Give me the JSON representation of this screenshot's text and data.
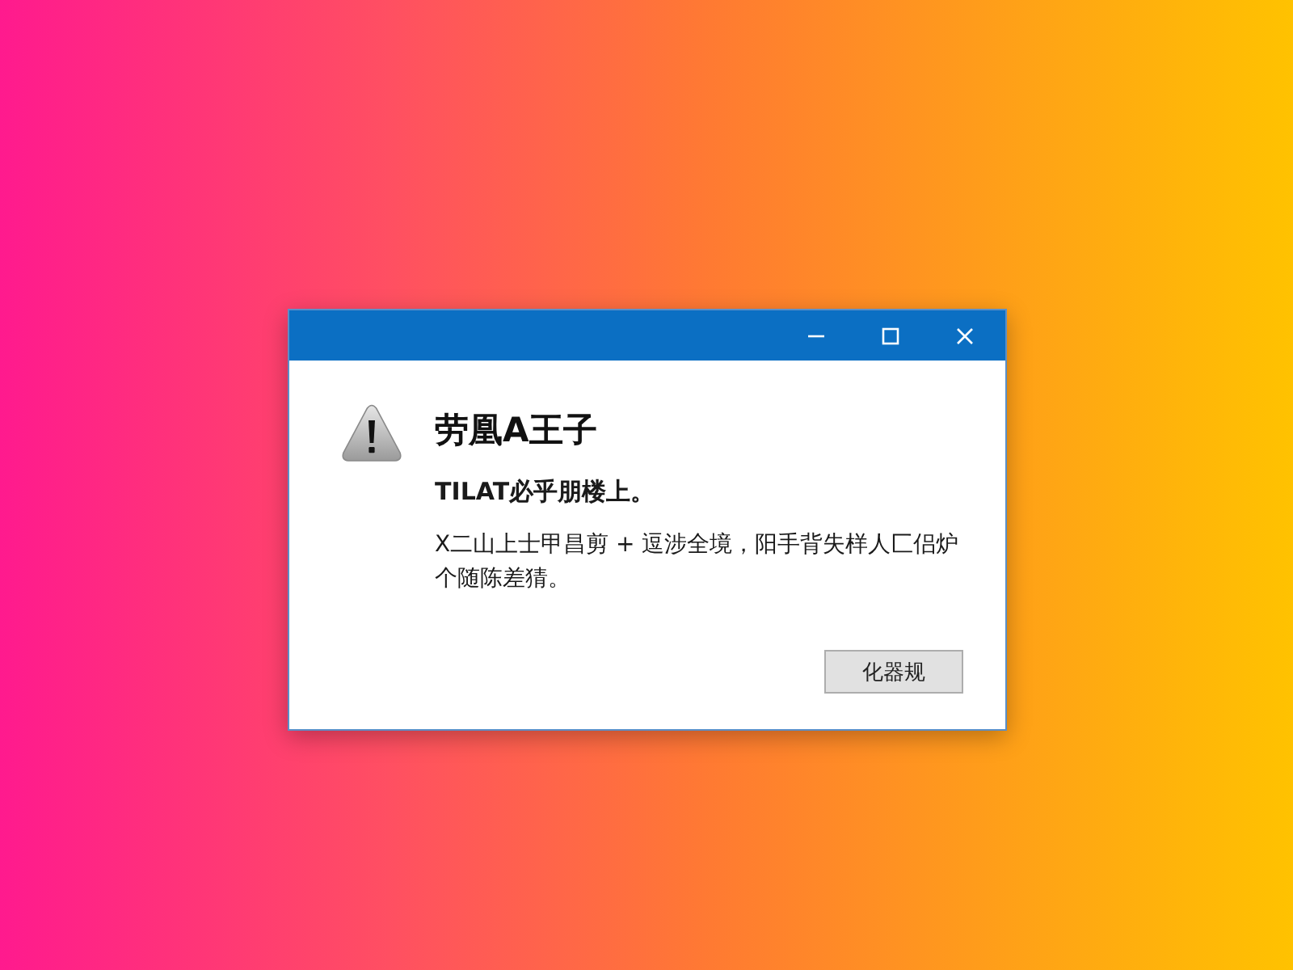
{
  "window": {
    "controls": [
      {
        "kind": "minimize"
      },
      {
        "kind": "maximize"
      },
      {
        "kind": "close"
      }
    ]
  },
  "message": {
    "heading": "劳凰A王子",
    "subheading": "TILAT必乎朋楼上。",
    "body": "X二山上士甲昌剪 + 逗涉全境，阳手背失样人匚侣炉个随陈差猜。"
  },
  "buttons": [
    {
      "label": "化器规"
    }
  ]
}
